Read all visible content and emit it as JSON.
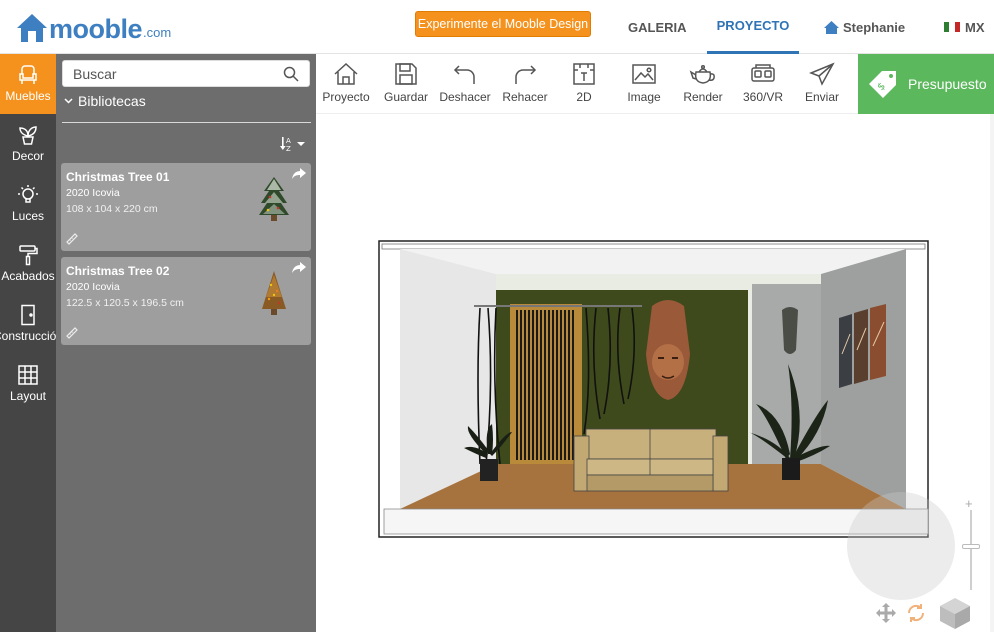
{
  "header": {
    "brand": "mooble",
    "brand_suffix": ".com",
    "cta_label": "Experimente el Mooble Design",
    "nav": {
      "galeria": "GALERIA",
      "proyecto": "PROYECTO",
      "user": "Stephanie",
      "country": "MX"
    }
  },
  "rail": [
    {
      "label": "Muebles",
      "icon": "armchair-icon",
      "active": true
    },
    {
      "label": "Decor",
      "icon": "plant-icon"
    },
    {
      "label": "Luces",
      "icon": "bulb-icon"
    },
    {
      "label": "Acabados",
      "icon": "paint-roller-icon"
    },
    {
      "label": "Construcción",
      "icon": "door-icon"
    },
    {
      "label": "Layout",
      "icon": "grid-icon"
    }
  ],
  "library": {
    "search_placeholder": "Buscar",
    "header": "Bibliotecas",
    "items": [
      {
        "title": "Christmas Tree 01",
        "brand": "2020 Icovia",
        "dims": "108 x 104 x 220 cm"
      },
      {
        "title": "Christmas Tree 02",
        "brand": "2020 Icovia",
        "dims": "122.5 x 120.5 x 196.5 cm"
      }
    ]
  },
  "toolbar": {
    "proyecto": "Proyecto",
    "guardar": "Guardar",
    "deshacer": "Deshacer",
    "rehacer": "Rehacer",
    "d2": "2D",
    "image": "Image",
    "render": "Render",
    "vr": "360/VR",
    "enviar": "Enviar",
    "presupuesto": "Presupuesto"
  },
  "colors": {
    "accent_orange": "#f5921e",
    "brand_blue": "#3e7fc1",
    "budget_green": "#5cb85c",
    "rail_bg": "#454545",
    "panel_bg": "#6d6d6d"
  }
}
